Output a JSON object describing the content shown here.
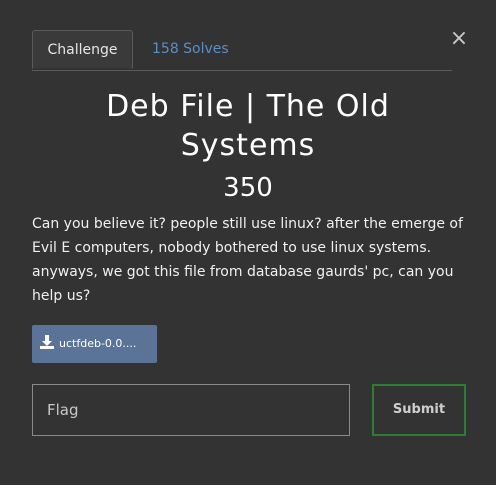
{
  "modal": {
    "close_label": "×",
    "tabs": {
      "challenge_label": "Challenge",
      "solves_label": "158 Solves"
    },
    "title": "Deb File | The Old Systems",
    "points": "350",
    "description": "Can you believe it? people still use linux? after the emerge of Evil E computers, nobody bothered to use linux systems. anyways, we got this file from database gaurds' pc, can you help us?",
    "file": {
      "label": "uctfdeb-0.0....",
      "icon": "download-icon"
    },
    "flag_input": {
      "placeholder": "Flag",
      "value": ""
    },
    "submit_label": "Submit"
  },
  "colors": {
    "background": "#333333",
    "link": "#5a8fc5",
    "file_button": "#5b7396",
    "submit_border": "#2e7d32"
  }
}
